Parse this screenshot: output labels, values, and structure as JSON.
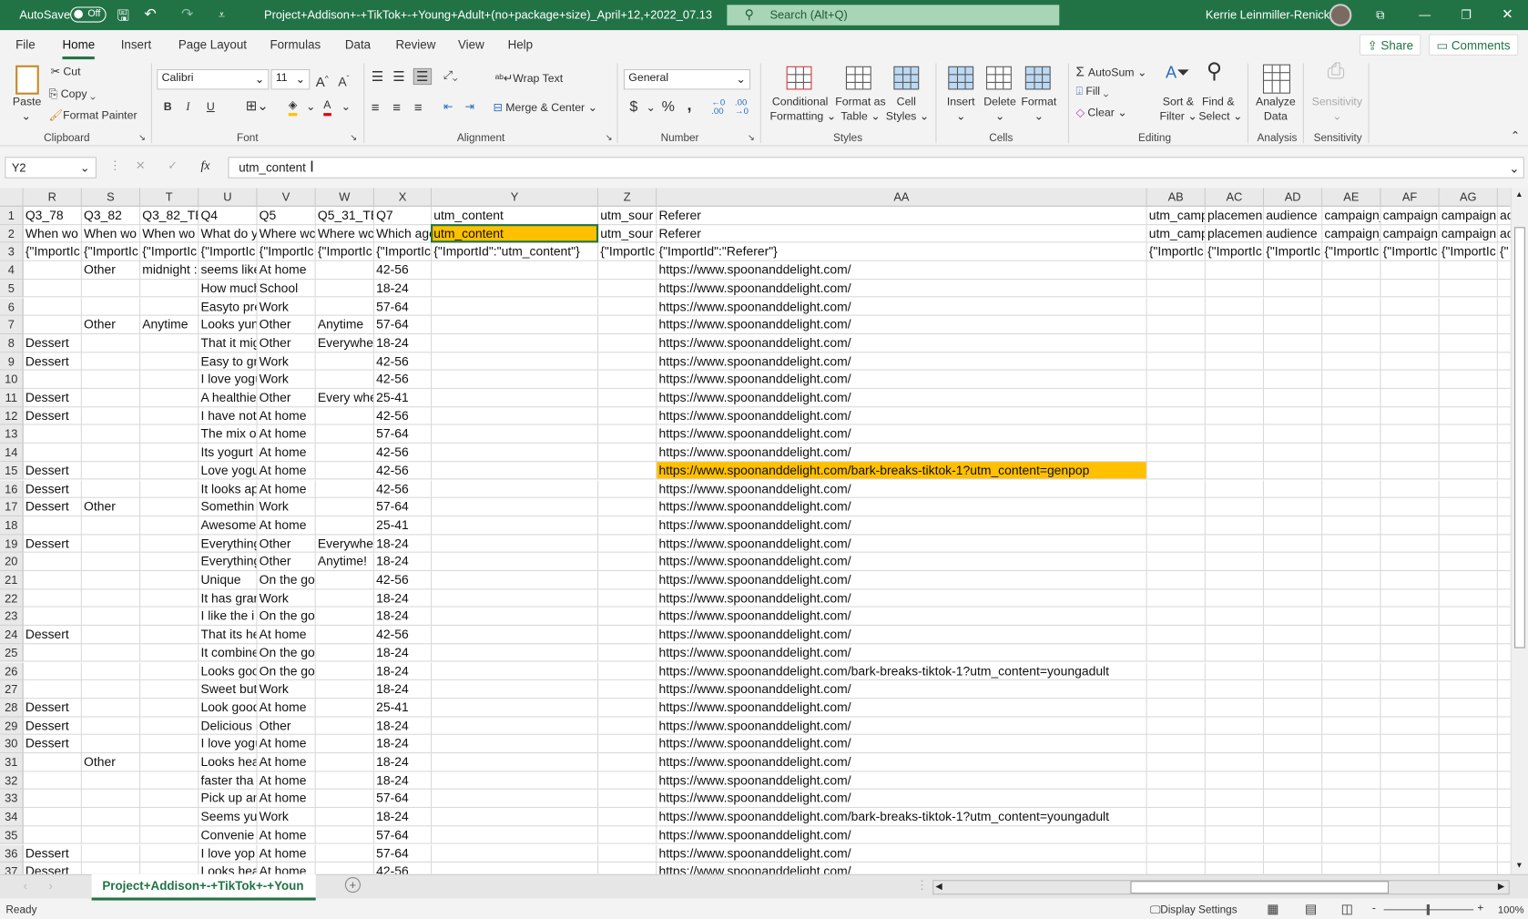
{
  "titlebar": {
    "autosave": "AutoSave",
    "autosave_state": "Off",
    "filename": "Project+Addison+-+TikTok+-+Young+Adult+(no+package+size)_April+12,+2022_07.13",
    "search_placeholder": "Search (Alt+Q)",
    "user": "Kerrie Leinmiller-Renick"
  },
  "menu": {
    "items": [
      "File",
      "Home",
      "Insert",
      "Page Layout",
      "Formulas",
      "Data",
      "Review",
      "View",
      "Help"
    ],
    "active": "Home",
    "share": "Share",
    "comments": "Comments"
  },
  "ribbon": {
    "clipboard": {
      "paste": "Paste",
      "cut": "Cut",
      "copy": "Copy",
      "format_painter": "Format Painter",
      "label": "Clipboard"
    },
    "font": {
      "name": "Calibri",
      "size": "11",
      "bold": "B",
      "italic": "I",
      "underline": "U",
      "label": "Font",
      "fill_color": "#ffc000",
      "font_color": "#e00000"
    },
    "alignment": {
      "wrap": "Wrap Text",
      "merge": "Merge & Center",
      "label": "Alignment"
    },
    "number": {
      "format": "General",
      "currency": "$",
      "percent": "%",
      "comma": ",",
      "label": "Number"
    },
    "styles": {
      "conditional": "Conditional",
      "conditional2": "Formatting",
      "format_table": "Format as",
      "format_table2": "Table",
      "cell_styles": "Cell",
      "cell_styles2": "Styles",
      "label": "Styles"
    },
    "cells": {
      "insert": "Insert",
      "delete": "Delete",
      "format": "Format",
      "label": "Cells"
    },
    "editing": {
      "autosum": "AutoSum",
      "fill": "Fill",
      "clear": "Clear",
      "sort": "Sort &",
      "sort2": "Filter",
      "find": "Find &",
      "find2": "Select",
      "label": "Editing"
    },
    "analysis": {
      "analyze": "Analyze",
      "analyze2": "Data",
      "label": "Analysis"
    },
    "sensitivity": {
      "button": "Sensitivity",
      "label": "Sensitivity"
    }
  },
  "formula_bar": {
    "name_box": "Y2",
    "fx": "fx",
    "value": "utm_content"
  },
  "sheet": {
    "columns": [
      "R",
      "S",
      "T",
      "U",
      "V",
      "W",
      "X",
      "Y",
      "Z",
      "AA",
      "AB",
      "AC",
      "AD",
      "AE",
      "AF",
      "AG",
      ""
    ],
    "header_rows": [
      [
        "Q3_78",
        "Q3_82",
        "Q3_82_TE",
        "Q4",
        "Q5",
        "Q5_31_TE",
        "Q7",
        "utm_content",
        "utm_sour",
        "Referer",
        "utm_camp",
        "placemen",
        "audience",
        "campaign_",
        "campaign.",
        "campaign.",
        "ac"
      ],
      [
        "When wo",
        "When wo",
        "When wo",
        "What do y",
        "Where wc",
        "Where wc",
        "Which age",
        "utm_content",
        "utm_sour",
        "Referer",
        "utm_camp",
        "placemen",
        "audience",
        "campaign_",
        "campaign.",
        "campaign.",
        "ac"
      ],
      [
        "{\"ImportIc",
        "{\"ImportIc",
        "{\"ImportIc",
        "{\"ImportIc",
        "{\"ImportIc",
        "{\"ImportIc",
        "{\"ImportIc",
        "{\"ImportId\":\"utm_content\"}",
        "{\"ImportIc",
        "{\"ImportId\":\"Referer\"}",
        "{\"ImportIc",
        "{\"ImportIc",
        "{\"ImportIc",
        "{\"ImportIc",
        "{\"ImportIc",
        "{\"ImportIc",
        "{\""
      ]
    ],
    "data_rows": [
      [
        "",
        "Other",
        "midnight :",
        "seems like",
        "At home",
        "",
        "42-56",
        "https://www.spoonanddelight.com/"
      ],
      [
        "",
        "",
        "",
        "How much",
        "School",
        "",
        "18-24",
        "https://www.spoonanddelight.com/"
      ],
      [
        "",
        "",
        "",
        "Easyto pre",
        "Work",
        "",
        "57-64",
        "https://www.spoonanddelight.com/"
      ],
      [
        "",
        "Other",
        "Anytime",
        "Looks yum",
        "Other",
        "Anytime",
        "57-64",
        "https://www.spoonanddelight.com/"
      ],
      [
        "Dessert",
        "",
        "",
        "That it mig",
        "Other",
        "Everywhe",
        "18-24",
        "https://www.spoonanddelight.com/"
      ],
      [
        "Dessert",
        "",
        "",
        "Easy to gra",
        "Work",
        "",
        "42-56",
        "https://www.spoonanddelight.com/"
      ],
      [
        "",
        "",
        "",
        "I love yogu",
        "Work",
        "",
        "42-56",
        "https://www.spoonanddelight.com/"
      ],
      [
        "Dessert",
        "",
        "",
        "A healthie",
        "Other",
        "Every whe",
        "25-41",
        "https://www.spoonanddelight.com/"
      ],
      [
        "Dessert",
        "",
        "",
        "I have not",
        "At home",
        "",
        "42-56",
        "https://www.spoonanddelight.com/"
      ],
      [
        "",
        "",
        "",
        "The mix o",
        "At home",
        "",
        "57-64",
        "https://www.spoonanddelight.com/"
      ],
      [
        "",
        "",
        "",
        "Its yogurt",
        "At home",
        "",
        "42-56",
        "https://www.spoonanddelight.com/"
      ],
      [
        "Dessert",
        "",
        "",
        "Love yogu",
        "At home",
        "",
        "42-56",
        "https://www.spoonanddelight.com/bark-breaks-tiktok-1?utm_content=genpop"
      ],
      [
        "Dessert",
        "",
        "",
        "It looks ap",
        "At home",
        "",
        "42-56",
        "https://www.spoonanddelight.com/"
      ],
      [
        "Dessert",
        "Other",
        "",
        "Somethin",
        "Work",
        "",
        "57-64",
        "https://www.spoonanddelight.com/"
      ],
      [
        "",
        "",
        "",
        "Awesome",
        "At home",
        "",
        "25-41",
        "https://www.spoonanddelight.com/"
      ],
      [
        "Dessert",
        "",
        "",
        "Everything",
        "Other",
        "Everywhe",
        "18-24",
        "https://www.spoonanddelight.com/"
      ],
      [
        "",
        "",
        "",
        "Everything",
        "Other",
        "Anytime!",
        "18-24",
        "https://www.spoonanddelight.com/"
      ],
      [
        "",
        "",
        "",
        "Unique",
        "On the go",
        "",
        "42-56",
        "https://www.spoonanddelight.com/"
      ],
      [
        "",
        "",
        "",
        "It has gran",
        "Work",
        "",
        "18-24",
        "https://www.spoonanddelight.com/"
      ],
      [
        "",
        "",
        "",
        "I like the i",
        "On the go",
        "",
        "18-24",
        "https://www.spoonanddelight.com/"
      ],
      [
        "Dessert",
        "",
        "",
        "That its he",
        "At home",
        "",
        "42-56",
        "https://www.spoonanddelight.com/"
      ],
      [
        "",
        "",
        "",
        "It combine",
        "On the go",
        "",
        "18-24",
        "https://www.spoonanddelight.com/"
      ],
      [
        "",
        "",
        "",
        "Looks goo",
        "On the go",
        "",
        "18-24",
        "https://www.spoonanddelight.com/bark-breaks-tiktok-1?utm_content=youngadult"
      ],
      [
        "",
        "",
        "",
        "Sweet but",
        "Work",
        "",
        "18-24",
        "https://www.spoonanddelight.com/"
      ],
      [
        "Dessert",
        "",
        "",
        "Look good",
        "At home",
        "",
        "25-41",
        "https://www.spoonanddelight.com/"
      ],
      [
        "Dessert",
        "",
        "",
        "Delicious",
        "Other",
        "",
        "18-24",
        "https://www.spoonanddelight.com/"
      ],
      [
        "Dessert",
        "",
        "",
        "I love yogu",
        "At home",
        "",
        "18-24",
        "https://www.spoonanddelight.com/"
      ],
      [
        "",
        "Other",
        "",
        "Looks hea",
        "At home",
        "",
        "18-24",
        "https://www.spoonanddelight.com/"
      ],
      [
        "",
        "",
        "",
        "faster tha",
        "At home",
        "",
        "18-24",
        "https://www.spoonanddelight.com/"
      ],
      [
        "",
        "",
        "",
        "Pick up an",
        "At home",
        "",
        "57-64",
        "https://www.spoonanddelight.com/"
      ],
      [
        "",
        "",
        "",
        "Seems yu",
        "Work",
        "",
        "18-24",
        "https://www.spoonanddelight.com/bark-breaks-tiktok-1?utm_content=youngadult"
      ],
      [
        "",
        "",
        "",
        "Convenie",
        "At home",
        "",
        "57-64",
        "https://www.spoonanddelight.com/"
      ],
      [
        "Dessert",
        "",
        "",
        "I love yop",
        "At home",
        "",
        "57-64",
        "https://www.spoonanddelight.com/"
      ],
      [
        "Dessert",
        "",
        "",
        "Looks hea",
        "At home",
        "",
        "42-56",
        "https://www.spoonanddelight.com/"
      ]
    ],
    "selected_cell": "Y2",
    "highlight_cells": [
      "Y2",
      "AA15"
    ],
    "highlight_color": "#ffc000"
  },
  "tabs": {
    "sheet_name": "Project+Addison+-+TikTok+-+Youn",
    "add": "+"
  },
  "status": {
    "ready": "Ready",
    "display_settings": "Display Settings",
    "zoom": "100%"
  }
}
